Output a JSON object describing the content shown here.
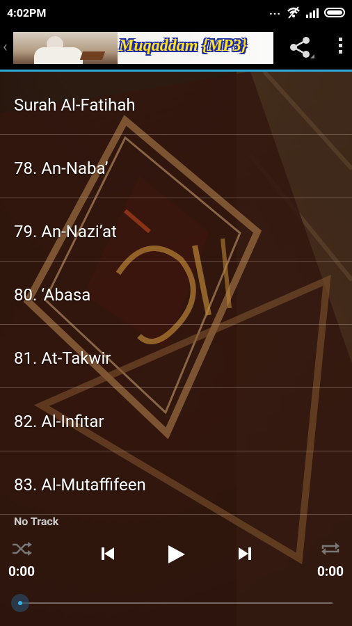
{
  "status_bar": {
    "time": "4:02PM",
    "dots": "..."
  },
  "action_bar": {
    "banner_title": "Muqaddam {MP3}"
  },
  "tracks": [
    {
      "label": "Surah Al-Fatihah"
    },
    {
      "label": "78. An-Naba’"
    },
    {
      "label": "79. An-Nazi’at"
    },
    {
      "label": "80. ‘Abasa"
    },
    {
      "label": "81. At-Takwir"
    },
    {
      "label": "82. Al-Infitar"
    },
    {
      "label": "83. Al-Mutaffifeen"
    }
  ],
  "player": {
    "now_playing": "No Track",
    "elapsed": "0:00",
    "total": "0:00",
    "seek_fraction": 0.0
  },
  "colors": {
    "accent": "#33a8dc",
    "banner_text": "#ffe020",
    "banner_outline": "#1b2aa8"
  }
}
